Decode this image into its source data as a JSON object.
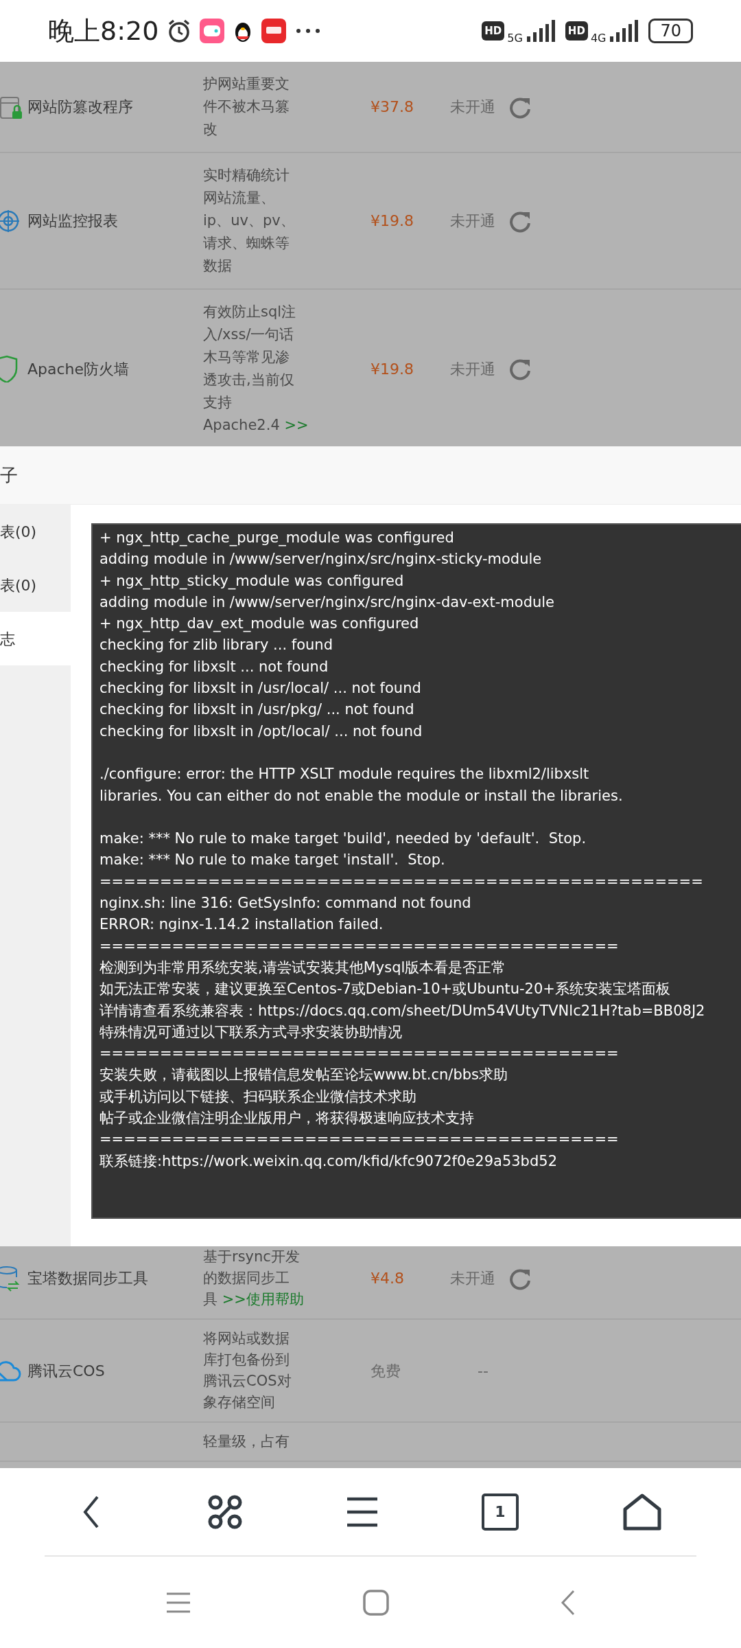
{
  "status_bar": {
    "time": "晚上8:20",
    "network": [
      {
        "hd": "HD",
        "generation": "5G"
      },
      {
        "hd": "HD",
        "generation": "4G"
      }
    ],
    "battery": "70"
  },
  "plugins_above": [
    {
      "name": "网站防篡改程序",
      "desc_lines": [
        "护网站重要文",
        "件不被木马篡",
        "改"
      ],
      "kind": "paid",
      "price": "¥37.8",
      "status": "未开通"
    },
    {
      "name": "网站监控报表",
      "desc_lines": [
        "实时精确统计",
        "网站流量、",
        "ip、uv、pv、",
        "请求、蜘蛛等",
        "数据"
      ],
      "kind": "paid",
      "price": "¥19.8",
      "status": "未开通"
    },
    {
      "name": "Apache防火墙",
      "desc_lines": [
        "有效防止sql注",
        "入/xss/一句话",
        "木马等常见渗",
        "透攻击,当前仅",
        "支持",
        "Apache2.4"
      ],
      "help_link": ">>",
      "kind": "paid",
      "price": "¥19.8",
      "status": "未开通"
    }
  ],
  "modal": {
    "title": "子",
    "tabs": [
      {
        "label": "表(0)",
        "selected": false
      },
      {
        "label": "表(0)",
        "selected": false
      },
      {
        "label": "志",
        "selected": true
      }
    ],
    "log_blocks": [
      [
        "+ ngx_http_cache_purge_module was configured",
        "adding module in /www/server/nginx/src/nginx-sticky-module",
        "+ ngx_http_sticky_module was configured",
        "adding module in /www/server/nginx/src/nginx-dav-ext-module",
        "+ ngx_http_dav_ext_module was configured",
        "checking for zlib library ... found",
        "checking for libxslt ... not found",
        "checking for libxslt in /usr/local/ ... not found",
        "checking for libxslt in /usr/pkg/ ... not found",
        "checking for libxslt in /opt/local/ ... not found"
      ],
      [
        "./configure: error: the HTTP XSLT module requires the libxml2/libxslt",
        "libraries. You can either do not enable the module or install the libraries."
      ],
      [
        "make: *** No rule to make target 'build', needed by 'default'.  Stop.",
        "make: *** No rule to make target 'install'.  Stop.",
        "==================================================",
        "nginx.sh: line 316: GetSysInfo: command not found",
        "ERROR: nginx-1.14.2 installation failed.",
        "===========================================",
        "检测到为非常用系统安装,请尝试安装其他Mysql版本看是否正常",
        "如无法正常安装，建议更换至Centos-7或Debian-10+或Ubuntu-20+系统安装宝塔面板",
        "详情请查看系统兼容表：https://docs.qq.com/sheet/DUm54VUtyTVNlc21H?tab=BB08J2",
        "特殊情况可通过以下联系方式寻求安装协助情况",
        "===========================================",
        "安装失败，请截图以上报错信息发帖至论坛www.bt.cn/bbs求助",
        "或手机访问以下链接、扫码联系企业微信技术求助",
        "帖子或企业微信注明企业版用户，将获得极速响应技术支持",
        "===========================================",
        "联系链接:https://work.weixin.qq.com/kfid/kfc9072f0e29a53bd52"
      ]
    ]
  },
  "plugins_below": [
    {
      "name": "宝塔数据同步工具",
      "desc_lines": [
        "基于rsync开发",
        "的数据同步工",
        "具"
      ],
      "help_link": ">>使用帮助",
      "kind": "paid",
      "price": "¥4.8",
      "status": "未开通"
    },
    {
      "name": "腾讯云COS",
      "desc_lines": [
        "将网站或数据",
        "库打包备份到",
        "腾讯云COS对",
        "象存储空间"
      ],
      "kind": "free",
      "price": "免费",
      "status": "--"
    },
    {
      "desc_lines": [
        "轻量级，占有"
      ]
    }
  ],
  "browser_toolbar": {
    "tab_count": "1"
  }
}
